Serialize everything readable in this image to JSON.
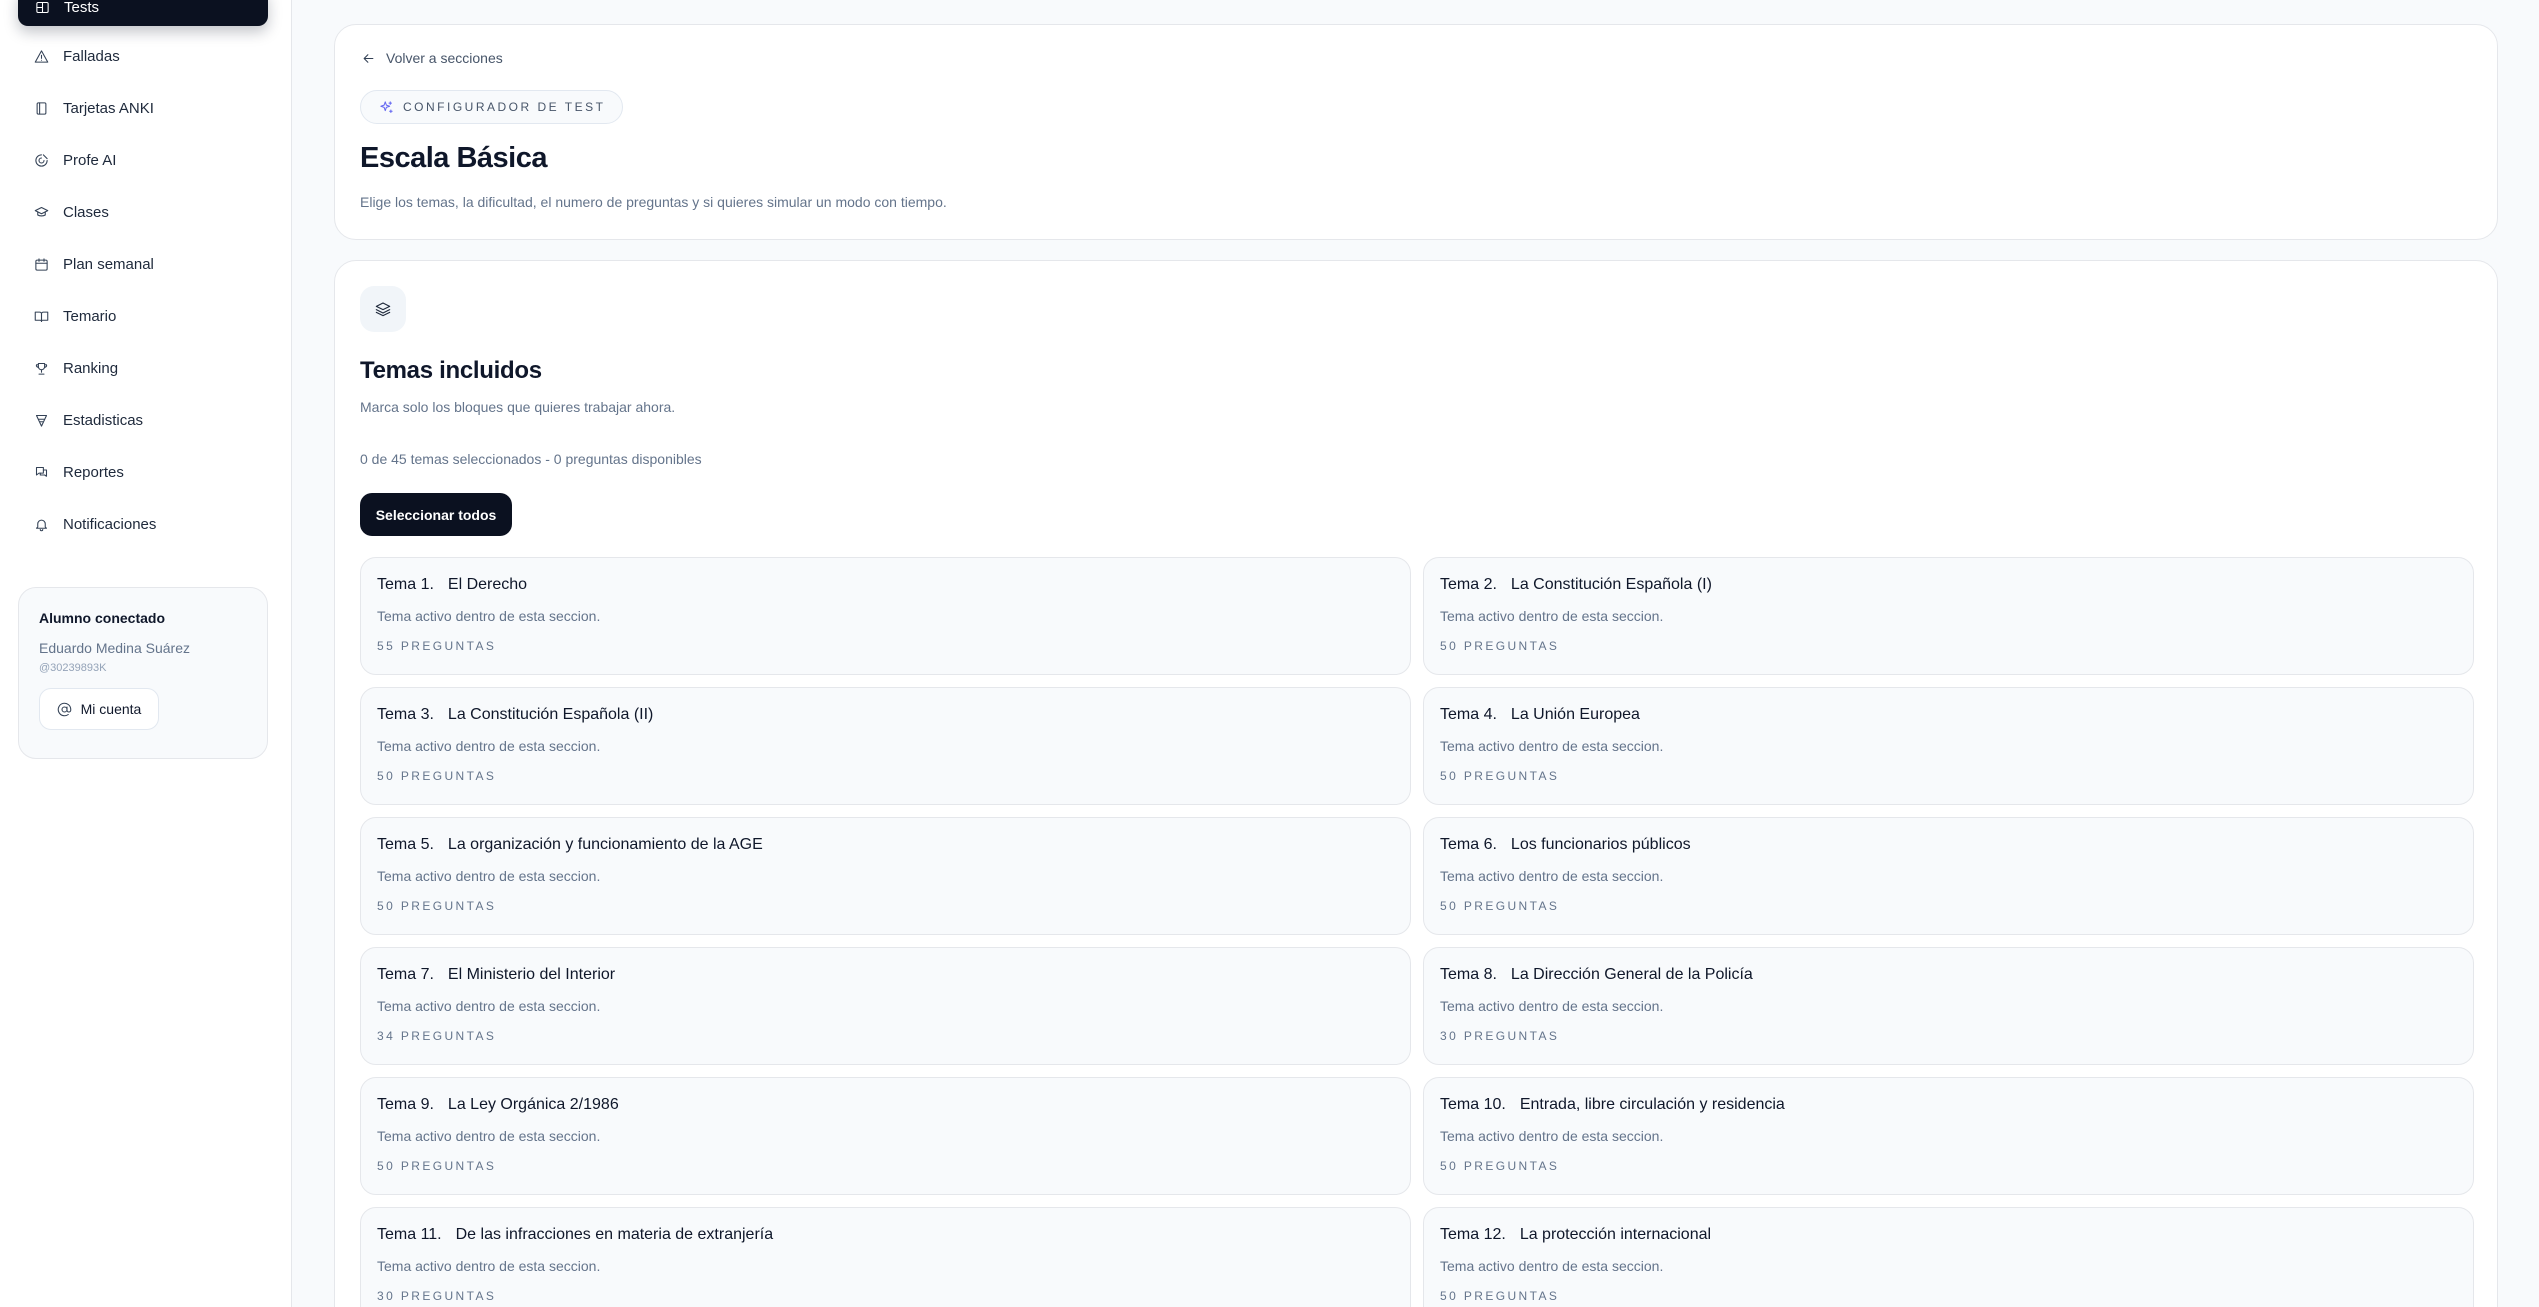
{
  "sidebar": {
    "active_item": {
      "label": "Tests",
      "icon": "test-icon"
    },
    "items": [
      {
        "label": "Falladas",
        "icon": "warning-icon"
      },
      {
        "label": "Tarjetas ANKI",
        "icon": "cards-icon"
      },
      {
        "label": "Profe AI",
        "icon": "ai-icon"
      },
      {
        "label": "Clases",
        "icon": "graduation-cap-icon"
      },
      {
        "label": "Plan semanal",
        "icon": "calendar-icon"
      },
      {
        "label": "Temario",
        "icon": "book-icon"
      },
      {
        "label": "Ranking",
        "icon": "trophy-icon"
      },
      {
        "label": "Estadisticas",
        "icon": "stats-icon"
      },
      {
        "label": "Reportes",
        "icon": "reports-icon"
      },
      {
        "label": "Notificaciones",
        "icon": "bell-icon"
      }
    ],
    "user": {
      "title": "Alumno conectado",
      "name": "Eduardo Medina Suárez",
      "id": "@30239893K",
      "account_button": "Mi cuenta"
    }
  },
  "header": {
    "back_label": "Volver a secciones",
    "badge": "CONFIGURADOR DE TEST",
    "title": "Escala Básica",
    "description": "Elige los temas, la dificultad, el numero de preguntas y si quieres simular un modo con tiempo."
  },
  "topics_section": {
    "title": "Temas incluidos",
    "subtitle": "Marca solo los bloques que quieres trabajar ahora.",
    "count_line": "0 de 45 temas seleccionados - 0 preguntas disponibles",
    "select_all_label": "Seleccionar todos",
    "topics": [
      {
        "num": "Tema 1.",
        "name": "El Derecho",
        "desc": "Tema activo dentro de esta seccion.",
        "count": "55 preguntas"
      },
      {
        "num": "Tema 2.",
        "name": "La Constitución Española (I)",
        "desc": "Tema activo dentro de esta seccion.",
        "count": "50 preguntas"
      },
      {
        "num": "Tema 3.",
        "name": "La Constitución Española (II)",
        "desc": "Tema activo dentro de esta seccion.",
        "count": "50 preguntas"
      },
      {
        "num": "Tema 4.",
        "name": "La Unión Europea",
        "desc": "Tema activo dentro de esta seccion.",
        "count": "50 preguntas"
      },
      {
        "num": "Tema 5.",
        "name": "La organización y funcionamiento de la AGE",
        "desc": "Tema activo dentro de esta seccion.",
        "count": "50 preguntas"
      },
      {
        "num": "Tema 6.",
        "name": "Los funcionarios públicos",
        "desc": "Tema activo dentro de esta seccion.",
        "count": "50 preguntas"
      },
      {
        "num": "Tema 7.",
        "name": "El Ministerio del Interior",
        "desc": "Tema activo dentro de esta seccion.",
        "count": "34 preguntas"
      },
      {
        "num": "Tema 8.",
        "name": "La Dirección General de la Policía",
        "desc": "Tema activo dentro de esta seccion.",
        "count": "30 preguntas"
      },
      {
        "num": "Tema 9.",
        "name": "La Ley Orgánica 2/1986",
        "desc": "Tema activo dentro de esta seccion.",
        "count": "50 preguntas"
      },
      {
        "num": "Tema 10.",
        "name": "Entrada, libre circulación y residencia",
        "desc": "Tema activo dentro de esta seccion.",
        "count": "50 preguntas"
      },
      {
        "num": "Tema 11.",
        "name": "De las infracciones en materia de extranjería",
        "desc": "Tema activo dentro de esta seccion.",
        "count": "30 preguntas"
      },
      {
        "num": "Tema 12.",
        "name": "La protección internacional",
        "desc": "Tema activo dentro de esta seccion.",
        "count": "50 preguntas"
      }
    ]
  }
}
